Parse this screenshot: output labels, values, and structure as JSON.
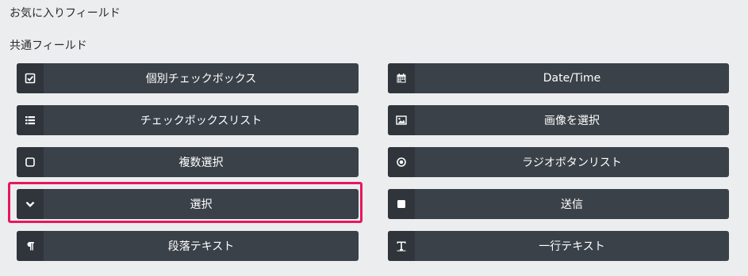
{
  "sections": {
    "favorites_title": "お気に入りフィールド",
    "common_title": "共通フィールド"
  },
  "fields": {
    "left": [
      {
        "label": "個別チェックボックス",
        "icon": "checkbox-checked-icon"
      },
      {
        "label": "チェックボックスリスト",
        "icon": "list-icon"
      },
      {
        "label": "複数選択",
        "icon": "checkbox-empty-icon"
      },
      {
        "label": "選択",
        "icon": "chevron-down-icon"
      },
      {
        "label": "段落テキスト",
        "icon": "paragraph-icon"
      }
    ],
    "right": [
      {
        "label": "Date/Time",
        "icon": "calendar-icon"
      },
      {
        "label": "画像を選択",
        "icon": "image-icon"
      },
      {
        "label": "ラジオボタンリスト",
        "icon": "radio-icon"
      },
      {
        "label": "送信",
        "icon": "square-icon"
      },
      {
        "label": "一行テキスト",
        "icon": "text-icon"
      }
    ]
  },
  "colors": {
    "background": "#ebedef",
    "button": "#3a4148",
    "icon_box": "#2f353b",
    "highlight": "#e8175d"
  },
  "highlighted_field": "選択"
}
